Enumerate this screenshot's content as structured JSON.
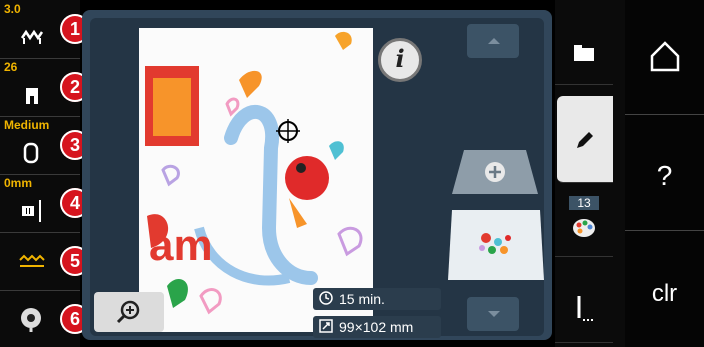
{
  "left_tools": [
    {
      "id": "stitch-width",
      "value": "3.0",
      "icon": "stitch-width-icon",
      "badge": "1"
    },
    {
      "id": "presser-foot",
      "value": "26",
      "icon": "presser-foot-icon",
      "badge": "2"
    },
    {
      "id": "tension",
      "value": "Medium",
      "icon": "thread-tension-icon",
      "badge": "3"
    },
    {
      "id": "needle-position",
      "value": "0mm",
      "icon": "needle-icon",
      "badge": "4"
    },
    {
      "id": "feed-dog",
      "value": "",
      "icon": "feed-dog-icon",
      "badge": "5"
    },
    {
      "id": "bobbin",
      "value": "",
      "icon": "bobbin-icon",
      "badge": "6"
    }
  ],
  "design": {
    "stitch_time": "15 min.",
    "size": "99×102 mm",
    "colors_count": "13"
  },
  "right_buttons": {
    "home": "home-icon",
    "help": "?",
    "clear": "clr"
  },
  "colors": {
    "badge_red": "#d6141e",
    "value_yellow": "#f0b400",
    "panel": "#31465a"
  }
}
